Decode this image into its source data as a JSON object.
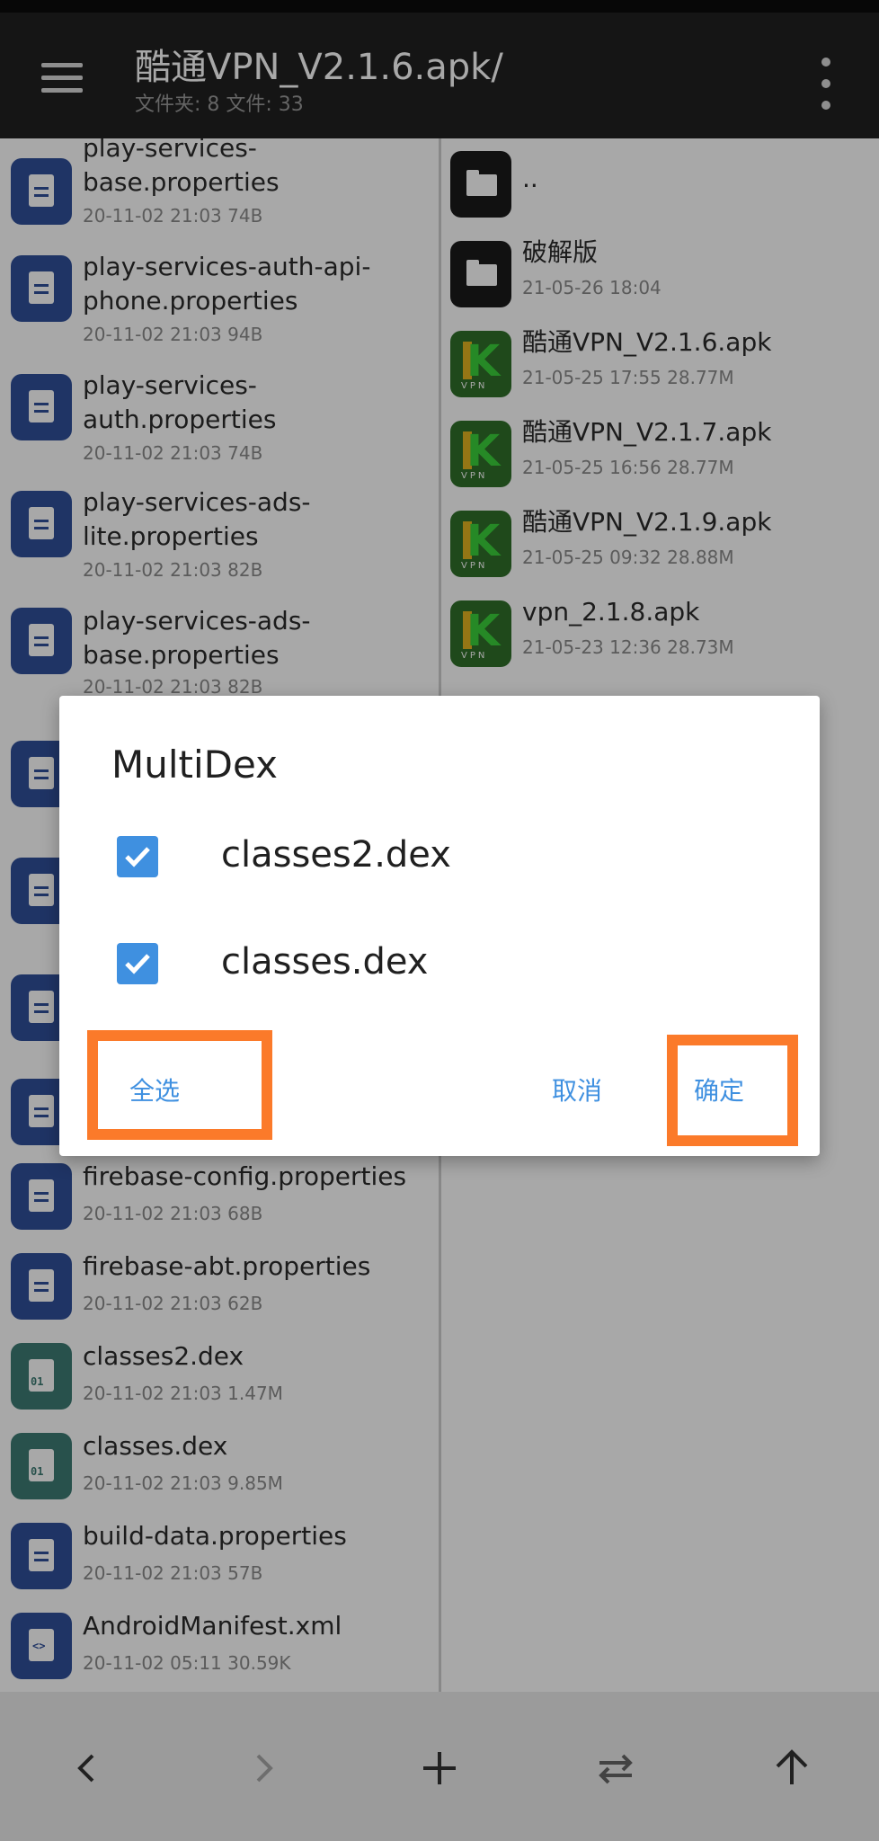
{
  "appbar": {
    "title": "酷通VPN_V2.1.6.apk/",
    "subtitle": "文件夹: 8   文件: 33",
    "menu_icon": "hamburger-menu-icon",
    "more_icon": "overflow-menu-icon"
  },
  "left_pane": {
    "files": [
      {
        "name": "play-services-base.properties",
        "meta": "20-11-02 21:03  74B",
        "icon": "document-icon"
      },
      {
        "name": "play-services-auth-api-phone.properties",
        "meta": "20-11-02 21:03  94B",
        "icon": "document-icon"
      },
      {
        "name": "play-services-auth.properties",
        "meta": "20-11-02 21:03  74B",
        "icon": "document-icon"
      },
      {
        "name": "play-services-ads-lite.properties",
        "meta": "20-11-02 21:03  82B",
        "icon": "document-icon"
      },
      {
        "name": "play-services-ads-base.properties",
        "meta": "20-11-02 21:03  82B",
        "icon": "document-icon"
      },
      {
        "name": "firebase-config.properties",
        "meta": "20-11-02 21:03  68B",
        "icon": "document-icon"
      },
      {
        "name": "firebase-abt.properties",
        "meta": "20-11-02 21:03  62B",
        "icon": "document-icon"
      },
      {
        "name": "classes2.dex",
        "meta": "20-11-02 21:03  1.47M",
        "icon": "dex-file-icon"
      },
      {
        "name": "classes.dex",
        "meta": "20-11-02 21:03  9.85M",
        "icon": "dex-file-icon"
      },
      {
        "name": "build-data.properties",
        "meta": "20-11-02 21:03  57B",
        "icon": "document-icon"
      },
      {
        "name": "AndroidManifest.xml",
        "meta": "20-11-02 05:11  30.59K",
        "icon": "xml-file-icon"
      }
    ]
  },
  "right_pane": {
    "files": [
      {
        "name": "..",
        "meta": "",
        "icon": "folder-icon"
      },
      {
        "name": "破解版",
        "meta": "21-05-26 18:04",
        "icon": "folder-icon"
      },
      {
        "name": "酷通VPN_V2.1.6.apk",
        "meta": "21-05-25 17:55  28.77M",
        "icon": "apk-icon"
      },
      {
        "name": "酷通VPN_V2.1.7.apk",
        "meta": "21-05-25 16:56  28.77M",
        "icon": "apk-icon"
      },
      {
        "name": "酷通VPN_V2.1.9.apk",
        "meta": "21-05-25 09:32  28.88M",
        "icon": "apk-icon"
      },
      {
        "name": "vpn_2.1.8.apk",
        "meta": "21-05-23 12:36  28.73M",
        "icon": "apk-icon"
      }
    ]
  },
  "dialog": {
    "title": "MultiDex",
    "items": [
      {
        "label": "classes2.dex",
        "checked": true
      },
      {
        "label": "classes.dex",
        "checked": true
      }
    ],
    "select_all": "全选",
    "cancel": "取消",
    "confirm": "确定"
  },
  "apk_icon_text": {
    "letter": "K",
    "caption": "VPN"
  },
  "dex_icon_text": "01",
  "xml_icon_text": "<>",
  "bottombar": {
    "icons": [
      "back-chevron-icon",
      "forward-chevron-icon",
      "add-icon",
      "swap-icon",
      "up-arrow-icon"
    ]
  },
  "colors": {
    "appbar": "#212121",
    "accent": "#3f90e0",
    "highlight": "#fb7a2a"
  }
}
